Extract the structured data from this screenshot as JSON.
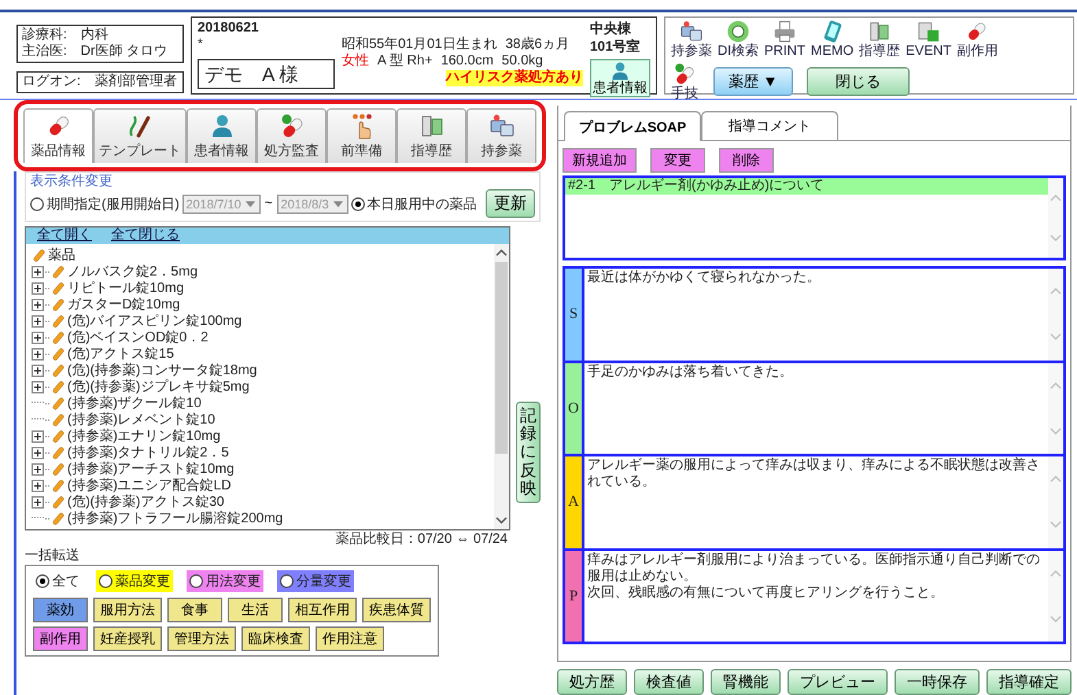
{
  "staff": {
    "lines": [
      "診療科:　内科",
      "主治医:　Dr医師 タロウ"
    ],
    "logon": "ログオン:　薬剤部管理者"
  },
  "patient": {
    "date": "20180621",
    "mark": "*",
    "name": "デモ　A 様",
    "birth": "昭和55年01月01日生まれ",
    "age": "38歳6ヵ月",
    "sex": "女性",
    "blood": "A 型 Rh+",
    "height": "160.0cm",
    "weight": "50.0kg",
    "alert": "ハイリスク薬処方あり",
    "ward": "中央棟",
    "room": "101号室",
    "info_button": "患者情報"
  },
  "toolbar": {
    "tools": [
      {
        "kind": "pills",
        "label": "持参薬"
      },
      {
        "kind": "disc",
        "label": "DI検索"
      },
      {
        "kind": "printer",
        "label": "PRINT"
      },
      {
        "kind": "tablet",
        "label": "MEMO"
      },
      {
        "kind": "document",
        "label": "指導歴"
      },
      {
        "kind": "calendar",
        "label": "EVENT"
      },
      {
        "kind": "capsule",
        "label": "副作用"
      }
    ],
    "extra_tool": {
      "kind": "capsule-check",
      "label": "手技"
    },
    "history_button": "薬歴 ▼",
    "close_button": "閉じる"
  },
  "main_tabs": {
    "highlighted": true,
    "tabs": [
      {
        "kind": "capsule",
        "label": "薬品情報",
        "selected": true
      },
      {
        "kind": "pen",
        "label": "テンプレート",
        "selected": false
      },
      {
        "kind": "person",
        "label": "患者情報",
        "selected": false
      },
      {
        "kind": "capsule-check",
        "label": "処方監査",
        "selected": false
      },
      {
        "kind": "hand",
        "label": "前準備",
        "selected": false
      },
      {
        "kind": "document",
        "label": "指導歴",
        "selected": false
      },
      {
        "kind": "pills",
        "label": "持参薬",
        "selected": false
      }
    ]
  },
  "filter": {
    "legend": "表示条件変更",
    "options": [
      {
        "label": "期間指定(服用開始日)",
        "selected": false
      },
      {
        "label": "本日服用中の薬品",
        "selected": true
      }
    ],
    "from": "2018/7/10",
    "separator": "~",
    "to": "2018/8/3",
    "dates_disabled": true,
    "update_button": "更新"
  },
  "tree": {
    "expand_all": "全て開く",
    "collapse_all": "全て閉じる",
    "root": "薬品",
    "items": [
      {
        "label": "ノルバスク錠2．5mg",
        "expandable": true
      },
      {
        "label": "リピトール錠10mg",
        "expandable": true
      },
      {
        "label": "ガスターD錠10mg",
        "expandable": true
      },
      {
        "label": "(危)バイアスピリン錠100mg",
        "expandable": true
      },
      {
        "label": "(危)ベイスンOD錠0．2",
        "expandable": true
      },
      {
        "label": "(危)アクトス錠15",
        "expandable": true
      },
      {
        "label": "(危)(持参薬)コンサータ錠18mg",
        "expandable": true
      },
      {
        "label": "(危)(持参薬)ジプレキサ錠5mg",
        "expandable": true
      },
      {
        "label": "(持参薬)ザクール錠10",
        "expandable": false
      },
      {
        "label": "(持参薬)レメベント錠10",
        "expandable": false
      },
      {
        "label": "(持参薬)エナリン錠10mg",
        "expandable": true
      },
      {
        "label": "(持参薬)タナトリル錠2．5",
        "expandable": true
      },
      {
        "label": "(持参薬)アーチスト錠10mg",
        "expandable": true
      },
      {
        "label": "(持参薬)ユニシア配合錠LD",
        "expandable": true
      },
      {
        "label": "(危)(持参薬)アクトス錠30",
        "expandable": true
      },
      {
        "label": "(持参薬)フトラフール腸溶錠200mg",
        "expandable": false
      }
    ]
  },
  "compare_date": "薬品比較日：07/20 ⇔ 07/24",
  "reflect_button": "記録に反映",
  "transfer": {
    "title": "一括転送",
    "filters": [
      {
        "label": "全て",
        "selected": true
      },
      {
        "label": "薬品変更",
        "selected": false,
        "color": "#ffff00"
      },
      {
        "label": "用法変更",
        "selected": false,
        "color": "#ee82ee"
      },
      {
        "label": "分量変更",
        "selected": false,
        "color": "#8080ff"
      }
    ],
    "categories": [
      {
        "label": "薬効",
        "color": "#6f9be8"
      },
      {
        "label": "服用方法",
        "color": "#f0e68c"
      },
      {
        "label": "食事",
        "color": "#f0e68c"
      },
      {
        "label": "生活",
        "color": "#f0e68c"
      },
      {
        "label": "相互作用",
        "color": "#f0e68c"
      },
      {
        "label": "疾患体質",
        "color": "#f0e68c"
      },
      {
        "label": "副作用",
        "color": "#ee82ee"
      },
      {
        "label": "妊産授乳",
        "color": "#f0e68c"
      },
      {
        "label": "管理方法",
        "color": "#f0e68c"
      },
      {
        "label": "臨床検査",
        "color": "#f0e68c"
      },
      {
        "label": "作用注意",
        "color": "#f0e68c"
      }
    ]
  },
  "record": {
    "tabs": [
      {
        "label": "プロブレムSOAP",
        "selected": true
      },
      {
        "label": "指導コメント",
        "selected": false
      }
    ],
    "actions": [
      "新規追加",
      "変更",
      "削除"
    ],
    "problems": [
      {
        "label": "#2-1　アレルギー剤(かゆみ止め)について",
        "selected": true
      }
    ],
    "soap": [
      {
        "letter": "S",
        "color": "#80c8ff",
        "lines": [
          "最近は体がかゆくて寝られなかった。"
        ]
      },
      {
        "letter": "O",
        "color": "#98f098",
        "lines": [
          "手足のかゆみは落ち着いてきた。"
        ]
      },
      {
        "letter": "A",
        "color": "#ffd700",
        "lines": [
          "アレルギー薬の服用によって痒みは収まり、痒みによる不眠状態は改善されている。"
        ]
      },
      {
        "letter": "P",
        "color": "#f070b0",
        "lines": [
          "痒みはアレルギー剤服用により治まっている。医師指示通り自己判断での服用は止めない。",
          "次回、残眠感の有無について再度ヒアリングを行うこと。"
        ]
      }
    ]
  },
  "bottom_buttons": [
    "処方歴",
    "検査値",
    "腎機能",
    "プレビュー",
    "一時保存",
    "指導確定"
  ]
}
